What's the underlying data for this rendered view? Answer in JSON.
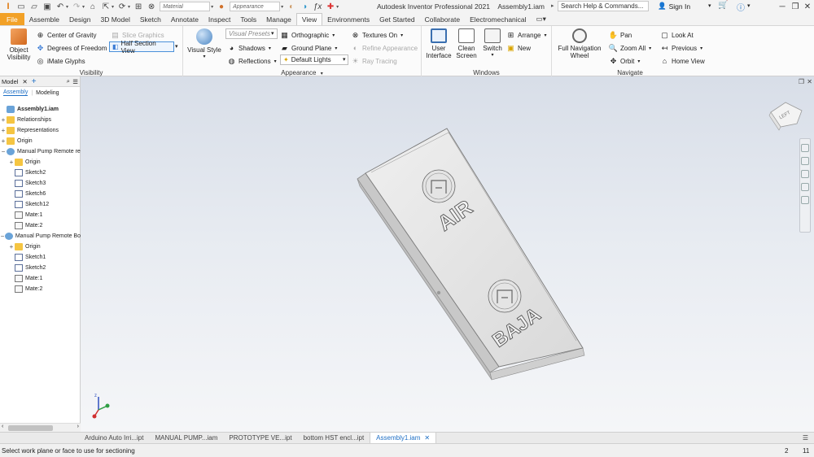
{
  "titlebar": {
    "material_placeholder": "Material",
    "appearance_placeholder": "Appearance",
    "app_title": "Autodesk Inventor Professional 2021",
    "file_title": "Assembly1.iam",
    "search_placeholder": "Search Help & Commands...",
    "sign_in": "Sign In"
  },
  "tabs": [
    "File",
    "Assemble",
    "Design",
    "3D Model",
    "Sketch",
    "Annotate",
    "Inspect",
    "Tools",
    "Manage",
    "View",
    "Environments",
    "Get Started",
    "Collaborate",
    "Electromechanical"
  ],
  "active_tab": "View",
  "ribbon": {
    "visibility": {
      "label": "Visibility",
      "object_visibility_1": "Object",
      "object_visibility_2": "Visibility",
      "center_of_gravity": "Center of Gravity",
      "degrees_of_freedom": "Degrees of Freedom",
      "imate_glyphs": "iMate Glyphs",
      "slice_graphics": "Slice Graphics",
      "section_view": "Half Section View"
    },
    "appearance": {
      "label": "Appearance",
      "visual_style": "Visual Style",
      "visual_presets": "Visual Presets",
      "shadows": "Shadows",
      "reflections": "Reflections",
      "orthographic": "Orthographic",
      "ground_plane": "Ground Plane",
      "default_lights": "Default Lights",
      "textures_on": "Textures On",
      "refine_appearance": "Refine Appearance",
      "ray_tracing": "Ray Tracing"
    },
    "windows": {
      "label": "Windows",
      "user_interface_1": "User",
      "user_interface_2": "Interface",
      "clean_screen_1": "Clean",
      "clean_screen_2": "Screen",
      "switch": "Switch",
      "arrange": "Arrange",
      "new": "New"
    },
    "navigate": {
      "label": "Navigate",
      "full_nav_1": "Full Navigation",
      "full_nav_2": "Wheel",
      "pan": "Pan",
      "zoom_all": "Zoom All",
      "orbit": "Orbit",
      "look_at": "Look At",
      "previous": "Previous",
      "home_view": "Home View"
    }
  },
  "browser": {
    "title": "Model",
    "sub_tabs": [
      "Assembly",
      "Modeling"
    ],
    "tree": [
      {
        "label": "Assembly1.iam",
        "level": 0,
        "icon": "asm",
        "exp": "",
        "bold": true
      },
      {
        "label": "Relationships",
        "level": 0,
        "icon": "folder",
        "exp": "+"
      },
      {
        "label": "Representations",
        "level": 0,
        "icon": "folder",
        "exp": "+"
      },
      {
        "label": "Origin",
        "level": 0,
        "icon": "folder",
        "exp": "+"
      },
      {
        "label": "Manual Pump Remote re",
        "level": 0,
        "icon": "part",
        "exp": "−"
      },
      {
        "label": "Origin",
        "level": 1,
        "icon": "folder",
        "exp": "+"
      },
      {
        "label": "Sketch2",
        "level": 1,
        "icon": "sketch",
        "exp": ""
      },
      {
        "label": "Sketch3",
        "level": 1,
        "icon": "sketch",
        "exp": ""
      },
      {
        "label": "Sketch6",
        "level": 1,
        "icon": "sketch",
        "exp": ""
      },
      {
        "label": "Sketch12",
        "level": 1,
        "icon": "sketch",
        "exp": ""
      },
      {
        "label": "Mate:1",
        "level": 1,
        "icon": "mate",
        "exp": ""
      },
      {
        "label": "Mate:2",
        "level": 1,
        "icon": "mate",
        "exp": ""
      },
      {
        "label": "Manual Pump Remote Bo",
        "level": 0,
        "icon": "part",
        "exp": "−"
      },
      {
        "label": "Origin",
        "level": 1,
        "icon": "folder",
        "exp": "+"
      },
      {
        "label": "Sketch1",
        "level": 1,
        "icon": "sketch",
        "exp": ""
      },
      {
        "label": "Sketch2",
        "level": 1,
        "icon": "sketch",
        "exp": ""
      },
      {
        "label": "Mate:1",
        "level": 1,
        "icon": "mate",
        "exp": ""
      },
      {
        "label": "Mate:2",
        "level": 1,
        "icon": "mate",
        "exp": ""
      }
    ]
  },
  "model": {
    "label_air": "AIR",
    "label_baja": "BAJA",
    "viewcube_face": "LEFT"
  },
  "doc_tabs": [
    "Arduino Auto Irri...ipt",
    "MANUAL PUMP...iam",
    "PROTOTYPE VE...ipt",
    "bottom HST encl...ipt",
    "Assembly1.iam"
  ],
  "active_doc": "Assembly1.iam",
  "status": {
    "message": "Select work plane or face to use for sectioning",
    "count_a": "2",
    "count_b": "11"
  }
}
